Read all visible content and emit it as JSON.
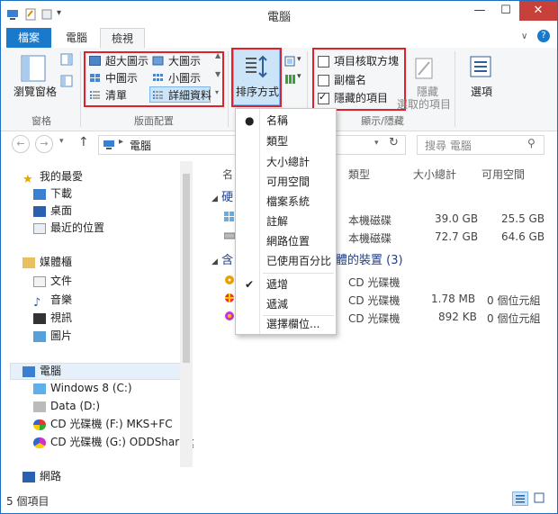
{
  "window": {
    "title": "電腦",
    "controls": {
      "minimize": "—",
      "maximize": "☐",
      "close": "✕"
    }
  },
  "ribbon_tabs": [
    {
      "label": "檔案",
      "state": "file"
    },
    {
      "label": "電腦",
      "state": "normal"
    },
    {
      "label": "檢視",
      "state": "active"
    }
  ],
  "ribbon": {
    "pane_group": {
      "button_label": "瀏覽窗格",
      "group_label": "窗格"
    },
    "layout_group": {
      "items": [
        "超大圖示",
        "大圖示",
        "中圖示",
        "小圖示",
        "清單",
        "詳細資料"
      ],
      "selected": "詳細資料",
      "group_label": "版面配置"
    },
    "sort_button": {
      "label": "排序方式"
    },
    "show_hide_group": {
      "checkboxes": [
        {
          "label": "項目核取方塊",
          "checked": false
        },
        {
          "label": "副檔名",
          "checked": false
        },
        {
          "label": "隱藏的項目",
          "checked": true
        }
      ],
      "hide_selected_label_1": "隱藏",
      "hide_selected_label_2": "選取的項目",
      "group_label": "顯示/隱藏"
    },
    "options_label": "選項"
  },
  "address": {
    "path": "電腦",
    "search_placeholder": "搜尋 電腦"
  },
  "nav_pane": {
    "favorites": {
      "label": "我的最愛",
      "items": [
        "下載",
        "桌面",
        "最近的位置"
      ]
    },
    "libraries": {
      "label": "媒體櫃",
      "items": [
        "文件",
        "音樂",
        "視訊",
        "圖片"
      ]
    },
    "computer": {
      "label": "電腦",
      "items": [
        "Windows 8 (C:)",
        "Data (D:)",
        "CD 光碟機 (F:) MKS+FC",
        "CD 光碟機 (G:) ODDSharing"
      ]
    },
    "network": {
      "label": "網路"
    }
  },
  "content": {
    "columns": [
      "名",
      "類型",
      "大小總計",
      "可用空間"
    ],
    "group1_prefix": "硬",
    "group2_prefix": "含",
    "group2_suffix": "體的裝置 (3)",
    "drives": [
      {
        "type": "本機磁碟",
        "total": "39.0 GB",
        "free": "25.5 GB"
      },
      {
        "type": "本機磁碟",
        "total": "72.7 GB",
        "free": "64.6 GB"
      }
    ],
    "devices": [
      {
        "type": "CD 光碟機",
        "total": "",
        "free": ""
      },
      {
        "type": "CD 光碟機",
        "total": "1.78 MB",
        "free": "0 個位元組"
      },
      {
        "type": "CD 光碟機",
        "total": "892 KB",
        "free": "0 個位元組"
      }
    ]
  },
  "sort_menu": {
    "items": [
      "名稱",
      "類型",
      "大小總計",
      "可用空間",
      "檔案系統",
      "註解",
      "網路位置",
      "已使用百分比"
    ],
    "selected": "名稱",
    "order": [
      "遞增",
      "遞減"
    ],
    "order_selected": "遞增",
    "choose_columns": "選擇欄位..."
  },
  "status": {
    "text": "5 個項目"
  },
  "colors": {
    "accent": "#1979ca",
    "highlight": "#e0202a",
    "selected_bg": "#cce4f7"
  }
}
